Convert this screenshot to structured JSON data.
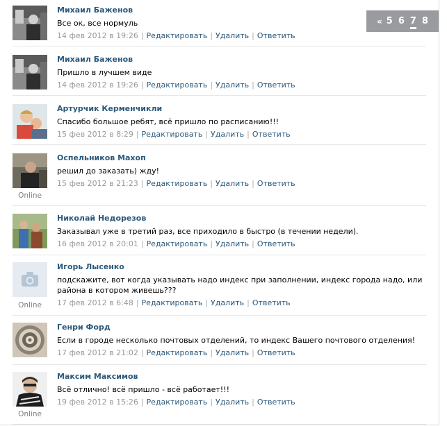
{
  "actions": {
    "edit": "Редактировать",
    "delete": "Удалить",
    "reply": "Ответить"
  },
  "online_label": "Online",
  "pager": {
    "prev": "«",
    "pages": [
      "5",
      "6",
      "7",
      "8"
    ],
    "current": "7"
  },
  "posts": [
    {
      "author": "Михаил Баженов",
      "text": "Все ок, все нормуль",
      "date": "14 фев 2012 в 19:26"
    },
    {
      "author": "Михаил Баженов",
      "text": "Пришло в лучшем виде",
      "date": "14 фев 2012 в 19:26"
    },
    {
      "author": "Артурчик Керменчикли",
      "text": "Спасибо большое ребят, всё пришло по расписанию!!!",
      "date": "15 фев 2012 в 8:29"
    },
    {
      "author": "Оспельников Махоп",
      "text": "решил до заказать) жду!",
      "date": "15 фев 2012 в 21:23"
    },
    {
      "author": "Николай Недорезов",
      "text": "Заказывал уже в третий раз, все приходило в быстро (в течении недели).",
      "date": "16 фев 2012 в 20:01"
    },
    {
      "author": "Игорь Лысенко",
      "text": "подскажите, вот когда указывать надо индекс при заполнении, индекс города надо, или района в котором живешь???",
      "date": "17 фев 2012 в 6:48"
    },
    {
      "author": "Генри Форд",
      "text": "Если в городе несколько почтовых отделений, то индекс Вашего почтового отделения!",
      "date": "17 фев 2012 в 21:02"
    },
    {
      "author": "Максим Максимов",
      "text": "Всё отлично! всё пришло - всё работает!!!",
      "date": "19 фев 2012 в 15:26"
    }
  ]
}
